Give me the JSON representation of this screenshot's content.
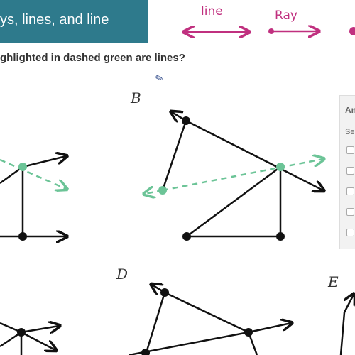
{
  "header": {
    "title": "ys, lines, and line",
    "banner_color": "#2e7a8c"
  },
  "annotations": {
    "line_label": "line",
    "ray_label": "Ray",
    "color": "#c0307f"
  },
  "question": {
    "text": "ghlighted in dashed green are lines?"
  },
  "figures": {
    "labels": [
      "B",
      "D",
      "E"
    ],
    "highlight_color": "#6cc497"
  },
  "answer_panel": {
    "heading": "An",
    "instruction": "Sel",
    "choice_count": 5
  }
}
